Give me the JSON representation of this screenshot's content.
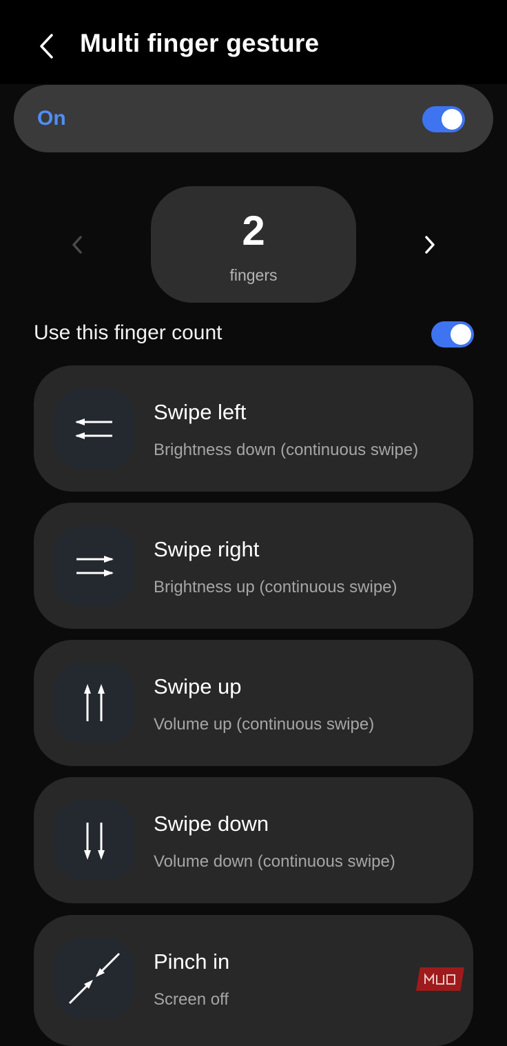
{
  "header": {
    "title": "Multi finger gesture",
    "back_icon": "chevron-left-icon"
  },
  "master_toggle": {
    "label": "On",
    "state": true,
    "accent_color": "#3e74ef"
  },
  "finger_count": {
    "value": "2",
    "unit": "fingers",
    "prev_icon": "chevron-left-icon",
    "next_icon": "chevron-right-icon"
  },
  "use_finger_count": {
    "label": "Use this finger count",
    "state": true
  },
  "gestures": [
    {
      "title": "Swipe left",
      "action": "Brightness down (continuous swipe)",
      "icon": "swipe-left-icon"
    },
    {
      "title": "Swipe right",
      "action": "Brightness up (continuous swipe)",
      "icon": "swipe-right-icon"
    },
    {
      "title": "Swipe up",
      "action": "Volume up (continuous swipe)",
      "icon": "swipe-up-icon"
    },
    {
      "title": "Swipe down",
      "action": "Volume down (continuous swipe)",
      "icon": "swipe-down-icon"
    },
    {
      "title": "Pinch in",
      "action": "Screen off",
      "icon": "pinch-in-icon"
    }
  ],
  "watermark": {
    "text": "MUO",
    "color": "#9f1b1b"
  }
}
